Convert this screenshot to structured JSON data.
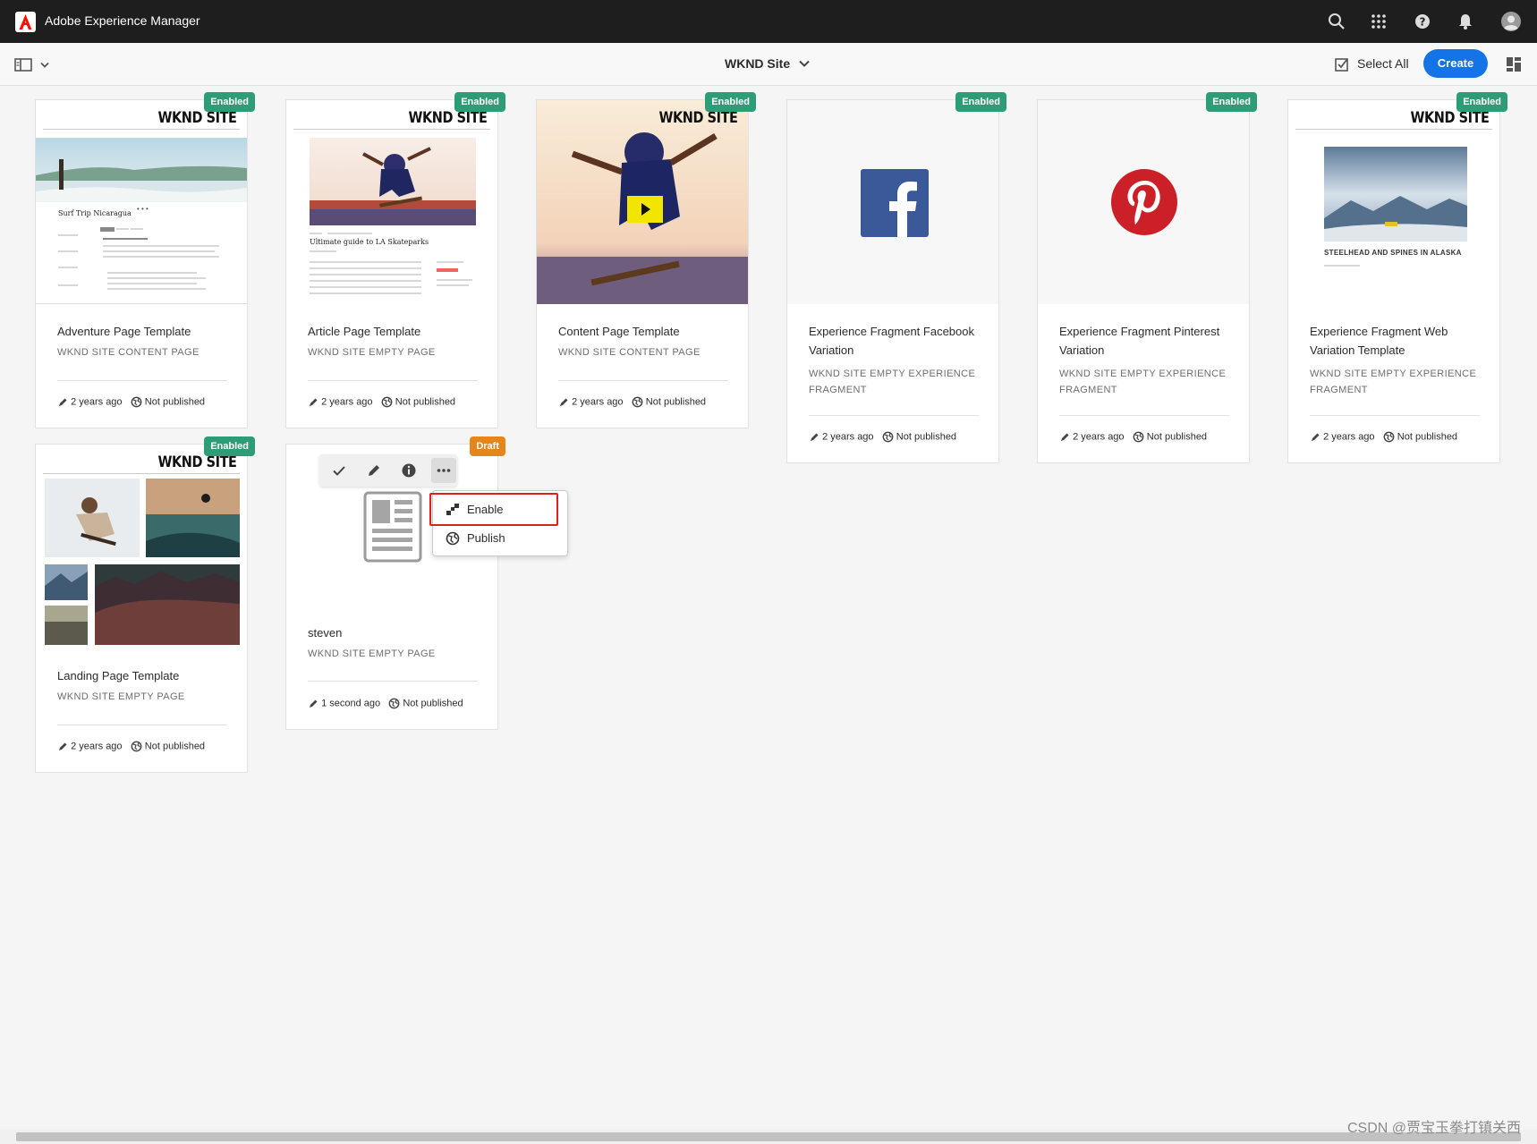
{
  "shell": {
    "app_title": "Adobe Experience Manager",
    "icons": [
      "search-icon",
      "apps-grid-icon",
      "help-icon",
      "bell-icon",
      "user-avatar-icon"
    ]
  },
  "actionbar": {
    "site_title": "WKND Site",
    "select_all": "Select All",
    "create": "Create"
  },
  "colors": {
    "accent": "#1473e6",
    "enabled_badge": "#2d9d78",
    "draft_badge": "#e68619",
    "highlight": "#e02020"
  },
  "thumb_texts": {
    "wknd": "WKND SITE",
    "adventure_heading": "Surf Trip Nicaragua",
    "article_heading": "Ultimate guide to LA Skateparks",
    "web_variation_caption": "STEELHEAD AND SPINES IN ALASKA"
  },
  "cards": [
    {
      "title": "Adventure Page Template",
      "subtitle": "WKND SITE CONTENT PAGE",
      "modified": "2 years ago",
      "publish": "Not published",
      "status": "Enabled"
    },
    {
      "title": "Article Page Template",
      "subtitle": "WKND SITE EMPTY PAGE",
      "modified": "2 years ago",
      "publish": "Not published",
      "status": "Enabled"
    },
    {
      "title": "Content Page Template",
      "subtitle": "WKND SITE CONTENT PAGE",
      "modified": "2 years ago",
      "publish": "Not published",
      "status": "Enabled"
    },
    {
      "title": "Experience Fragment Facebook Variation",
      "subtitle": "WKND SITE EMPTY EXPERIENCE FRAGMENT",
      "modified": "2 years ago",
      "publish": "Not published",
      "status": "Enabled"
    },
    {
      "title": "Experience Fragment Pinterest Variation",
      "subtitle": "WKND SITE EMPTY EXPERIENCE FRAGMENT",
      "modified": "2 years ago",
      "publish": "Not published",
      "status": "Enabled"
    },
    {
      "title": "Experience Fragment Web Variation Template",
      "subtitle": "WKND SITE EMPTY EXPERIENCE FRAGMENT",
      "modified": "2 years ago",
      "publish": "Not published",
      "status": "Enabled"
    },
    {
      "title": "Landing Page Template",
      "subtitle": "WKND SITE EMPTY PAGE",
      "modified": "2 years ago",
      "publish": "Not published",
      "status": "Enabled"
    },
    {
      "title": "steven",
      "subtitle": "WKND SITE EMPTY PAGE",
      "modified": "1 second ago",
      "publish": "Not published",
      "status": "Draft"
    }
  ],
  "quick_actions": [
    "check-icon",
    "edit-pencil-icon",
    "info-icon",
    "more-icon"
  ],
  "menu": {
    "items": [
      {
        "label": "Enable",
        "icon": "enable-icon"
      },
      {
        "label": "Publish",
        "icon": "globe-icon"
      }
    ]
  },
  "watermark": "CSDN @贾宝玉拳打镇关西"
}
